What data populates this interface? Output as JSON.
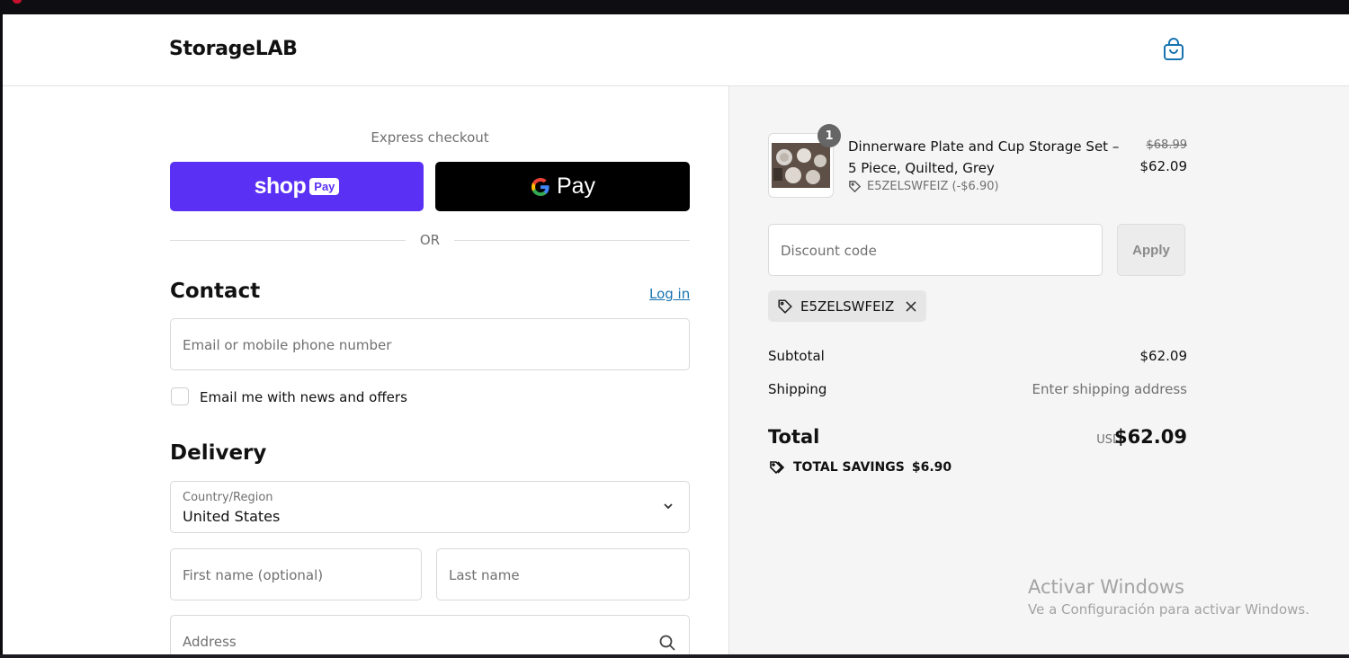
{
  "header": {
    "brand": "StorageLAB",
    "cart_icon": "shopping-bag-icon"
  },
  "express": {
    "label": "Express checkout",
    "shop_pay": {
      "shop_text": "shop",
      "pay_text": "Pay"
    },
    "google_pay": {
      "pay_text": "Pay"
    },
    "or_text": "OR"
  },
  "contact": {
    "title": "Contact",
    "login_link": "Log in",
    "email_placeholder": "Email or mobile phone number",
    "newsletter_label": "Email me with news and offers"
  },
  "delivery": {
    "title": "Delivery",
    "country_label": "Country/Region",
    "country_value": "United States",
    "first_name_placeholder": "First name (optional)",
    "last_name_placeholder": "Last name",
    "address_placeholder": "Address"
  },
  "order": {
    "item": {
      "quantity": "1",
      "title": "Dinnerware Plate and Cup Storage Set – 5 Piece, Quilted, Grey",
      "discount": "E5ZELSWFEIZ (-$6.90)",
      "price_original": "$68.99",
      "price_discounted": "$62.09"
    },
    "discount_placeholder": "Discount code",
    "apply_label": "Apply",
    "applied_code": "E5ZELSWFEIZ",
    "subtotal_label": "Subtotal",
    "subtotal_value": "$62.09",
    "shipping_label": "Shipping",
    "shipping_value": "Enter shipping address",
    "total_label": "Total",
    "total_currency": "USD",
    "total_value": "$62.09",
    "savings_label": "TOTAL SAVINGS",
    "savings_value": "$6.90"
  },
  "watermark": {
    "line1": "Activar Windows",
    "line2": "Ve a Configuración para activar Windows."
  },
  "colors": {
    "shop_pay": "#5a31f4",
    "link": "#1773b0",
    "summary_bg": "#f5f5f5"
  }
}
